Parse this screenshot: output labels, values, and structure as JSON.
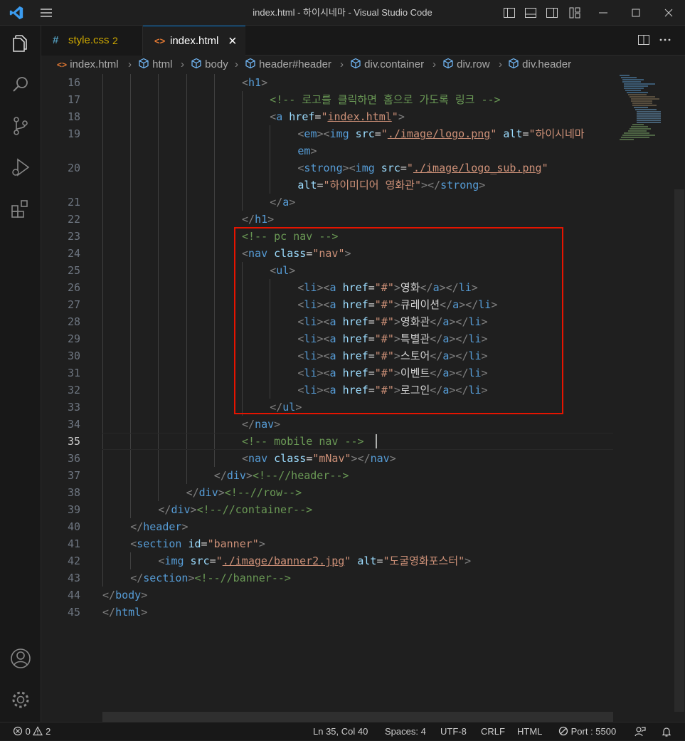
{
  "window": {
    "title": "index.html - 하이시네마 - Visual Studio Code"
  },
  "tabs": [
    {
      "label": "style.css",
      "badge": "2",
      "icon": "css-hash-icon"
    },
    {
      "label": "index.html",
      "icon": "html-brackets-icon",
      "close": "×"
    }
  ],
  "breadcrumb": [
    "index.html",
    "html",
    "body",
    "header#header",
    "div.container",
    "div.row",
    "div.header"
  ],
  "code": {
    "current_line": 35,
    "lines": [
      {
        "n": "16",
        "indent": 5,
        "segs": [
          [
            "p",
            "<"
          ],
          [
            "t",
            "h1"
          ],
          [
            "p",
            ">"
          ]
        ]
      },
      {
        "n": "17",
        "indent": 6,
        "segs": [
          [
            "c",
            "<!-- 로고를 클릭하면 홈으로 가도록 링크 -->"
          ]
        ]
      },
      {
        "n": "18",
        "indent": 6,
        "segs": [
          [
            "p",
            "<"
          ],
          [
            "t",
            "a"
          ],
          [
            "w",
            " "
          ],
          [
            "a",
            "href"
          ],
          [
            "w",
            "="
          ],
          [
            "s",
            "\""
          ],
          [
            "su",
            "index.html"
          ],
          [
            "s",
            "\""
          ],
          [
            "p",
            ">"
          ]
        ]
      },
      {
        "n": "19",
        "indent": 7,
        "segs": [
          [
            "p",
            "<"
          ],
          [
            "t",
            "em"
          ],
          [
            "p",
            "><"
          ],
          [
            "t",
            "img"
          ],
          [
            "w",
            " "
          ],
          [
            "a",
            "src"
          ],
          [
            "w",
            "="
          ],
          [
            "s",
            "\""
          ],
          [
            "su",
            "./image/logo.png"
          ],
          [
            "s",
            "\""
          ],
          [
            "w",
            " "
          ],
          [
            "a",
            "alt"
          ],
          [
            "w",
            "="
          ],
          [
            "s",
            "\"하이시네마"
          ]
        ]
      },
      {
        "n": "",
        "indent": 7,
        "segs": [
          [
            "t",
            "em"
          ],
          [
            "p",
            ">"
          ]
        ]
      },
      {
        "n": "20",
        "indent": 7,
        "segs": [
          [
            "p",
            "<"
          ],
          [
            "t",
            "strong"
          ],
          [
            "p",
            "><"
          ],
          [
            "t",
            "img"
          ],
          [
            "w",
            " "
          ],
          [
            "a",
            "src"
          ],
          [
            "w",
            "="
          ],
          [
            "s",
            "\""
          ],
          [
            "su",
            "./image/logo_sub.png"
          ],
          [
            "s",
            "\""
          ]
        ]
      },
      {
        "n": "",
        "indent": 7,
        "segs": [
          [
            "a",
            "alt"
          ],
          [
            "w",
            "="
          ],
          [
            "s",
            "\"하이미디어 영화관\""
          ],
          [
            "p",
            "></"
          ],
          [
            "t",
            "strong"
          ],
          [
            "p",
            ">"
          ]
        ]
      },
      {
        "n": "21",
        "indent": 6,
        "segs": [
          [
            "p",
            "</"
          ],
          [
            "t",
            "a"
          ],
          [
            "p",
            ">"
          ]
        ]
      },
      {
        "n": "22",
        "indent": 5,
        "segs": [
          [
            "p",
            "</"
          ],
          [
            "t",
            "h1"
          ],
          [
            "p",
            ">"
          ]
        ]
      },
      {
        "n": "23",
        "indent": 5,
        "segs": [
          [
            "c",
            "<!-- pc nav -->"
          ]
        ]
      },
      {
        "n": "24",
        "indent": 5,
        "segs": [
          [
            "p",
            "<"
          ],
          [
            "t",
            "nav"
          ],
          [
            "w",
            " "
          ],
          [
            "a",
            "class"
          ],
          [
            "w",
            "="
          ],
          [
            "s",
            "\"nav\""
          ],
          [
            "p",
            ">"
          ]
        ]
      },
      {
        "n": "25",
        "indent": 6,
        "segs": [
          [
            "p",
            "<"
          ],
          [
            "t",
            "ul"
          ],
          [
            "p",
            ">"
          ]
        ]
      },
      {
        "n": "26",
        "indent": 7,
        "segs": [
          [
            "p",
            "<"
          ],
          [
            "t",
            "li"
          ],
          [
            "p",
            "><"
          ],
          [
            "t",
            "a"
          ],
          [
            "w",
            " "
          ],
          [
            "a",
            "href"
          ],
          [
            "w",
            "="
          ],
          [
            "s",
            "\"#\""
          ],
          [
            "p",
            ">"
          ],
          [
            "w",
            "영화"
          ],
          [
            "p",
            "</"
          ],
          [
            "t",
            "a"
          ],
          [
            "p",
            "></"
          ],
          [
            "t",
            "li"
          ],
          [
            "p",
            ">"
          ]
        ]
      },
      {
        "n": "27",
        "indent": 7,
        "segs": [
          [
            "p",
            "<"
          ],
          [
            "t",
            "li"
          ],
          [
            "p",
            "><"
          ],
          [
            "t",
            "a"
          ],
          [
            "w",
            " "
          ],
          [
            "a",
            "href"
          ],
          [
            "w",
            "="
          ],
          [
            "s",
            "\"#\""
          ],
          [
            "p",
            ">"
          ],
          [
            "w",
            "큐레이션"
          ],
          [
            "p",
            "</"
          ],
          [
            "t",
            "a"
          ],
          [
            "p",
            "></"
          ],
          [
            "t",
            "li"
          ],
          [
            "p",
            ">"
          ]
        ]
      },
      {
        "n": "28",
        "indent": 7,
        "segs": [
          [
            "p",
            "<"
          ],
          [
            "t",
            "li"
          ],
          [
            "p",
            "><"
          ],
          [
            "t",
            "a"
          ],
          [
            "w",
            " "
          ],
          [
            "a",
            "href"
          ],
          [
            "w",
            "="
          ],
          [
            "s",
            "\"#\""
          ],
          [
            "p",
            ">"
          ],
          [
            "w",
            "영화관"
          ],
          [
            "p",
            "</"
          ],
          [
            "t",
            "a"
          ],
          [
            "p",
            "></"
          ],
          [
            "t",
            "li"
          ],
          [
            "p",
            ">"
          ]
        ]
      },
      {
        "n": "29",
        "indent": 7,
        "segs": [
          [
            "p",
            "<"
          ],
          [
            "t",
            "li"
          ],
          [
            "p",
            "><"
          ],
          [
            "t",
            "a"
          ],
          [
            "w",
            " "
          ],
          [
            "a",
            "href"
          ],
          [
            "w",
            "="
          ],
          [
            "s",
            "\"#\""
          ],
          [
            "p",
            ">"
          ],
          [
            "w",
            "특별관"
          ],
          [
            "p",
            "</"
          ],
          [
            "t",
            "a"
          ],
          [
            "p",
            "></"
          ],
          [
            "t",
            "li"
          ],
          [
            "p",
            ">"
          ]
        ]
      },
      {
        "n": "30",
        "indent": 7,
        "segs": [
          [
            "p",
            "<"
          ],
          [
            "t",
            "li"
          ],
          [
            "p",
            "><"
          ],
          [
            "t",
            "a"
          ],
          [
            "w",
            " "
          ],
          [
            "a",
            "href"
          ],
          [
            "w",
            "="
          ],
          [
            "s",
            "\"#\""
          ],
          [
            "p",
            ">"
          ],
          [
            "w",
            "스토어"
          ],
          [
            "p",
            "</"
          ],
          [
            "t",
            "a"
          ],
          [
            "p",
            "></"
          ],
          [
            "t",
            "li"
          ],
          [
            "p",
            ">"
          ]
        ]
      },
      {
        "n": "31",
        "indent": 7,
        "segs": [
          [
            "p",
            "<"
          ],
          [
            "t",
            "li"
          ],
          [
            "p",
            "><"
          ],
          [
            "t",
            "a"
          ],
          [
            "w",
            " "
          ],
          [
            "a",
            "href"
          ],
          [
            "w",
            "="
          ],
          [
            "s",
            "\"#\""
          ],
          [
            "p",
            ">"
          ],
          [
            "w",
            "이벤트"
          ],
          [
            "p",
            "</"
          ],
          [
            "t",
            "a"
          ],
          [
            "p",
            "></"
          ],
          [
            "t",
            "li"
          ],
          [
            "p",
            ">"
          ]
        ]
      },
      {
        "n": "32",
        "indent": 7,
        "segs": [
          [
            "p",
            "<"
          ],
          [
            "t",
            "li"
          ],
          [
            "p",
            "><"
          ],
          [
            "t",
            "a"
          ],
          [
            "w",
            " "
          ],
          [
            "a",
            "href"
          ],
          [
            "w",
            "="
          ],
          [
            "s",
            "\"#\""
          ],
          [
            "p",
            ">"
          ],
          [
            "w",
            "로그인"
          ],
          [
            "p",
            "</"
          ],
          [
            "t",
            "a"
          ],
          [
            "p",
            "></"
          ],
          [
            "t",
            "li"
          ],
          [
            "p",
            ">"
          ]
        ]
      },
      {
        "n": "33",
        "indent": 6,
        "segs": [
          [
            "p",
            "</"
          ],
          [
            "t",
            "ul"
          ],
          [
            "p",
            ">"
          ]
        ]
      },
      {
        "n": "34",
        "indent": 5,
        "segs": [
          [
            "p",
            "</"
          ],
          [
            "t",
            "nav"
          ],
          [
            "p",
            ">"
          ]
        ]
      },
      {
        "n": "35",
        "indent": 5,
        "segs": [
          [
            "c",
            "<!-- mobile nav -->"
          ]
        ]
      },
      {
        "n": "36",
        "indent": 5,
        "segs": [
          [
            "p",
            "<"
          ],
          [
            "t",
            "nav"
          ],
          [
            "w",
            " "
          ],
          [
            "a",
            "class"
          ],
          [
            "w",
            "="
          ],
          [
            "s",
            "\"mNav\""
          ],
          [
            "p",
            "></"
          ],
          [
            "t",
            "nav"
          ],
          [
            "p",
            ">"
          ]
        ]
      },
      {
        "n": "37",
        "indent": 4,
        "segs": [
          [
            "p",
            "</"
          ],
          [
            "t",
            "div"
          ],
          [
            "p",
            ">"
          ],
          [
            "c",
            "<!--//header-->"
          ]
        ]
      },
      {
        "n": "38",
        "indent": 3,
        "segs": [
          [
            "p",
            "</"
          ],
          [
            "t",
            "div"
          ],
          [
            "p",
            ">"
          ],
          [
            "c",
            "<!--//row-->"
          ]
        ]
      },
      {
        "n": "39",
        "indent": 2,
        "segs": [
          [
            "p",
            "</"
          ],
          [
            "t",
            "div"
          ],
          [
            "p",
            ">"
          ],
          [
            "c",
            "<!--//container-->"
          ]
        ]
      },
      {
        "n": "40",
        "indent": 1,
        "segs": [
          [
            "p",
            "</"
          ],
          [
            "t",
            "header"
          ],
          [
            "p",
            ">"
          ]
        ]
      },
      {
        "n": "41",
        "indent": 1,
        "segs": [
          [
            "p",
            "<"
          ],
          [
            "t",
            "section"
          ],
          [
            "w",
            " "
          ],
          [
            "a",
            "id"
          ],
          [
            "w",
            "="
          ],
          [
            "s",
            "\"banner\""
          ],
          [
            "p",
            ">"
          ]
        ]
      },
      {
        "n": "42",
        "indent": 2,
        "segs": [
          [
            "p",
            "<"
          ],
          [
            "t",
            "img"
          ],
          [
            "w",
            " "
          ],
          [
            "a",
            "src"
          ],
          [
            "w",
            "="
          ],
          [
            "s",
            "\""
          ],
          [
            "su",
            "./image/banner2.jpg"
          ],
          [
            "s",
            "\""
          ],
          [
            "w",
            " "
          ],
          [
            "a",
            "alt"
          ],
          [
            "w",
            "="
          ],
          [
            "s",
            "\"도굴영화포스터\""
          ],
          [
            "p",
            ">"
          ]
        ]
      },
      {
        "n": "43",
        "indent": 1,
        "segs": [
          [
            "p",
            "</"
          ],
          [
            "t",
            "section"
          ],
          [
            "p",
            ">"
          ],
          [
            "c",
            "<!--//banner-->"
          ]
        ]
      },
      {
        "n": "44",
        "indent": 0,
        "segs": [
          [
            "p",
            "</"
          ],
          [
            "t",
            "body"
          ],
          [
            "p",
            ">"
          ]
        ]
      },
      {
        "n": "45",
        "indent": 0,
        "segs": [
          [
            "p",
            "</"
          ],
          [
            "t",
            "html"
          ],
          [
            "p",
            ">"
          ]
        ]
      }
    ]
  },
  "status": {
    "errors": "0",
    "warnings": "2",
    "position": "Ln 35, Col 40",
    "spaces": "Spaces: 4",
    "encoding": "UTF-8",
    "eol": "CRLF",
    "language": "HTML",
    "port": "Port : 5500"
  },
  "colors": {
    "highlight_box": "#e51400",
    "accent": "#0078d4"
  }
}
